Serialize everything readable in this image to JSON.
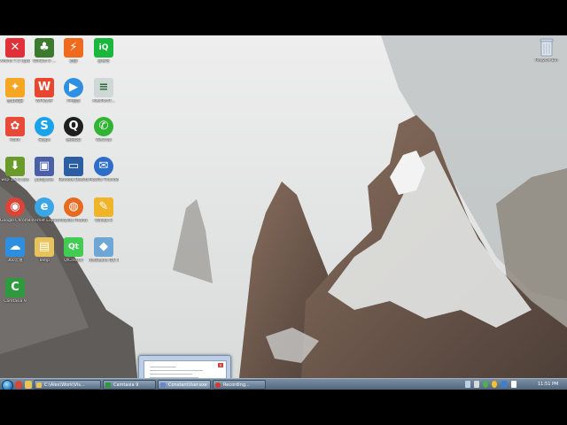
{
  "desktop": {
    "icons": [
      {
        "label": "XMind 7.5 Update 1",
        "icon": "xmind-icon",
        "color": "#e0303a",
        "glyph": "✕"
      },
      {
        "label": "WinEdt 9 ...",
        "icon": "winedt-tree-icon",
        "color": "#3c7a2e",
        "glyph": "♣"
      },
      {
        "label": "迅雷",
        "icon": "xunlei-icon",
        "color": "#ef6a1c",
        "glyph": "⚡"
      },
      {
        "label": "爱奇艺",
        "icon": "iqiyi-icon",
        "color": "#19b73b",
        "glyph": "iQ"
      },
      {
        "label": "金山词霸",
        "icon": "kingsoft-dict-icon",
        "color": "#f5a623",
        "glyph": "✦"
      },
      {
        "label": "WPS文字",
        "icon": "wps-icon",
        "color": "#e9452f",
        "glyph": "W"
      },
      {
        "label": "PP视频",
        "icon": "pp-video-icon",
        "color": "#2f8fe0",
        "glyph": "▶"
      },
      {
        "label": "AlexPortT...",
        "icon": "document-icon",
        "color": "#cfd8d6",
        "glyph": "≡"
      },
      {
        "label": "Paint",
        "icon": "paint-icon",
        "color": "#e84a3a",
        "glyph": "✿"
      },
      {
        "label": "Skype",
        "icon": "skype-icon",
        "color": "#1aa3e8",
        "glyph": "S"
      },
      {
        "label": "腾讯QQ",
        "icon": "qq-icon",
        "color": "#1f1f1f",
        "glyph": "Q"
      },
      {
        "label": "WeChat",
        "icon": "wechat-icon",
        "color": "#31b334",
        "glyph": "✆"
      },
      {
        "label": "wsp-1.3.5.exe",
        "icon": "installer-icon",
        "color": "#6a9a2a",
        "glyph": "⬇"
      },
      {
        "label": "putty.exe",
        "icon": "putty-icon",
        "color": "#4a5fa8",
        "glyph": "▣"
      },
      {
        "label": "Remote Desktop ...",
        "icon": "remote-desktop-icon",
        "color": "#2b5ea3",
        "glyph": "▭"
      },
      {
        "label": "Mozilla Thunderbird",
        "icon": "thunderbird-icon",
        "color": "#2d6ec9",
        "glyph": "✉"
      },
      {
        "label": "Google Chrome",
        "icon": "chrome-icon",
        "color": "#db4437",
        "glyph": "◉"
      },
      {
        "label": "Internet Explorer",
        "icon": "ie-icon",
        "color": "#3aa6e5",
        "glyph": "e"
      },
      {
        "label": "Mozilla Firefox",
        "icon": "firefox-icon",
        "color": "#e66a1f",
        "glyph": "◍"
      },
      {
        "label": "Winlab 8",
        "icon": "winlab-icon",
        "color": "#f0b429",
        "glyph": "✎"
      },
      {
        "label": "360云盘",
        "icon": "cloud-drive-icon",
        "color": "#2d8fde",
        "glyph": "☁"
      },
      {
        "label": "Temp",
        "icon": "folder-icon",
        "color": "#e8c25a",
        "glyph": "▤"
      },
      {
        "label": "QtCreator",
        "icon": "qtcreator-icon",
        "color": "#41cd52",
        "glyph": "Qt"
      },
      {
        "label": "NetBeans IDE 8.1",
        "icon": "netbeans-icon",
        "color": "#6ea6d6",
        "glyph": "◆"
      },
      {
        "label": "Camtasia 9",
        "icon": "camtasia-icon",
        "color": "#2f9a3d",
        "glyph": "C"
      }
    ],
    "recycle_bin": {
      "label": "Recycle Bin",
      "icon": "recycle-bin-icon"
    }
  },
  "taskbar": {
    "start_icon": "windows-start-icon",
    "quick_launch": [
      {
        "icon": "chrome-icon",
        "color": "#db4437"
      },
      {
        "icon": "folder-icon",
        "color": "#e8c25a"
      }
    ],
    "tasks": [
      {
        "label": "C:\\Alex\\Work\\Vis...",
        "icon": "folder-icon",
        "color": "#e8c25a"
      },
      {
        "label": "Camtasia 9",
        "icon": "camtasia-icon",
        "color": "#2f9a3d"
      },
      {
        "label": "ConstantUser.exe",
        "icon": "app-window-icon",
        "color": "#6a89c4"
      },
      {
        "label": "Recording...",
        "icon": "record-icon",
        "color": "#d23a2f"
      }
    ],
    "tray_icons": [
      "network-icon",
      "volume-icon",
      "security-icon",
      "update-icon",
      "language-icon",
      "flag-icon"
    ],
    "clock": "11:51 PM"
  }
}
